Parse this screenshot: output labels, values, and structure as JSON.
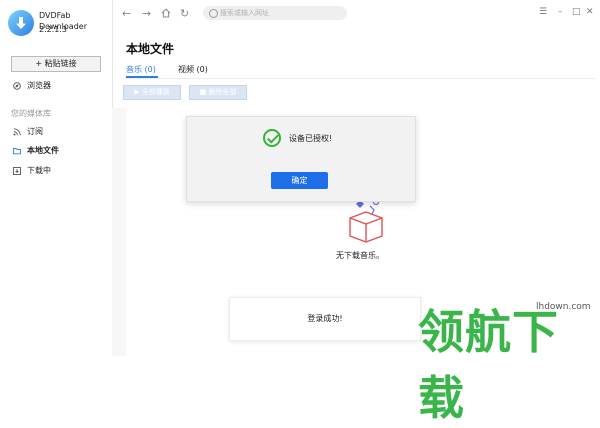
{
  "app": {
    "name": "DVDFab Downloader",
    "version": "2.2.1.3"
  },
  "sidebar": {
    "paste_button": "粘贴链接",
    "browser_label": "浏览器",
    "library_section": "您的媒体库",
    "items": [
      {
        "label": "订阅",
        "icon": "rss-icon"
      },
      {
        "label": "本地文件",
        "icon": "folder-icon"
      },
      {
        "label": "下载中",
        "icon": "download-icon"
      }
    ]
  },
  "topbar": {
    "search_placeholder": "搜索或输入网址",
    "nav_icons": [
      "back-icon",
      "forward-icon",
      "home-icon",
      "refresh-icon"
    ]
  },
  "main": {
    "title": "本地文件",
    "tabs": [
      {
        "label": "音乐 (0)",
        "active": true
      },
      {
        "label": "视频 (0)",
        "active": false
      }
    ],
    "play_all": "全部播放",
    "delete_all": "删除全部",
    "empty_text": "无下载音乐。"
  },
  "dialog": {
    "message": "设备已授权!",
    "ok_label": "确定"
  },
  "toast": {
    "message": "登录成功!"
  },
  "watermark": {
    "text": "领航下载",
    "url": "lhdown.com"
  },
  "colors": {
    "accent": "#2b7de9",
    "primary_button": "#1d6ee8",
    "success": "#34b33b",
    "watermark": "#39b54a"
  }
}
